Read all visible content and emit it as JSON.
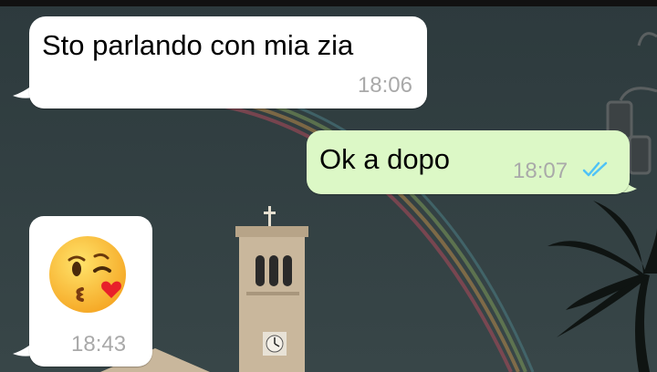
{
  "chat": {
    "messages": [
      {
        "direction": "incoming",
        "text": "Sto parlando con mia zia",
        "time": "18:06"
      },
      {
        "direction": "outgoing",
        "text": "Ok a dopo",
        "time": "18:07",
        "status": "read"
      },
      {
        "direction": "incoming",
        "emoji": "face-blowing-a-kiss",
        "time": "18:43"
      }
    ]
  },
  "colors": {
    "incoming_bubble": "#ffffff",
    "outgoing_bubble": "#dcf8c6",
    "time_text": "#a9a9a9",
    "read_ticks": "#4fc3f7"
  }
}
